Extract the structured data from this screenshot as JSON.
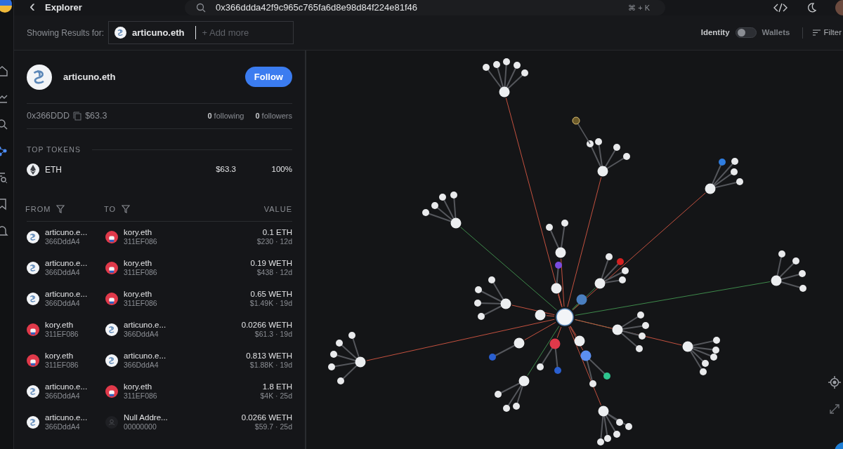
{
  "header": {
    "back": "‹",
    "title": "Explorer",
    "search": {
      "value": "0x366ddda42f9c965c765fa6d8e98d84f224e81f46",
      "shortcut": "⌘ + K"
    }
  },
  "sidebar": {
    "items": [
      {
        "kind": "home",
        "selected": false
      },
      {
        "kind": "chart",
        "selected": false
      },
      {
        "kind": "search",
        "selected": false
      },
      {
        "kind": "graph",
        "selected": true
      },
      {
        "kind": "doc-search",
        "selected": false
      },
      {
        "kind": "bookmark",
        "selected": false
      },
      {
        "kind": "bell",
        "selected": false
      }
    ]
  },
  "results_bar": {
    "label": "Showing Results for:",
    "chips": [
      {
        "name": "articuno.eth",
        "kind": "articuno"
      }
    ],
    "add_placeholder": "+ Add more"
  },
  "view_toggle": {
    "left_label": "Identity",
    "right_label": "Wallets",
    "on": false,
    "filter": "Filter"
  },
  "profile": {
    "name": "articuno.eth",
    "kind": "articuno",
    "follow": "Follow",
    "address": "0x366DDD",
    "balance": "$63.3",
    "following_count": "0",
    "following_label": "following",
    "followers_count": "0",
    "followers_label": "followers"
  },
  "top_tokens": {
    "title": "TOP TOKENS",
    "items": [
      {
        "symbol": "ETH",
        "value": "$63.3",
        "share": "100%"
      }
    ]
  },
  "transfers": {
    "columns": [
      "FROM",
      "TO",
      "VALUE"
    ],
    "rows": [
      {
        "from": {
          "name": "articuno.e...",
          "address": "366DddA4",
          "kind": "articuno"
        },
        "to": {
          "name": "kory.eth",
          "address": "311EF086",
          "kind": "kory"
        },
        "amount": "0.1 ETH",
        "detail": "$230 · 12d"
      },
      {
        "from": {
          "name": "articuno.e...",
          "address": "366DddA4",
          "kind": "articuno"
        },
        "to": {
          "name": "kory.eth",
          "address": "311EF086",
          "kind": "kory"
        },
        "amount": "0.19 WETH",
        "detail": "$438 · 12d"
      },
      {
        "from": {
          "name": "articuno.e...",
          "address": "366DddA4",
          "kind": "articuno"
        },
        "to": {
          "name": "kory.eth",
          "address": "311EF086",
          "kind": "kory"
        },
        "amount": "0.65 WETH",
        "detail": "$1.49K · 19d"
      },
      {
        "from": {
          "name": "kory.eth",
          "address": "311EF086",
          "kind": "kory"
        },
        "to": {
          "name": "articuno.e...",
          "address": "366DddA4",
          "kind": "articuno"
        },
        "amount": "0.0266 WETH",
        "detail": "$61.3 · 19d"
      },
      {
        "from": {
          "name": "kory.eth",
          "address": "311EF086",
          "kind": "kory"
        },
        "to": {
          "name": "articuno.e...",
          "address": "366DddA4",
          "kind": "articuno"
        },
        "amount": "0.813 WETH",
        "detail": "$1.88K · 19d"
      },
      {
        "from": {
          "name": "articuno.e...",
          "address": "366DddA4",
          "kind": "articuno"
        },
        "to": {
          "name": "kory.eth",
          "address": "311EF086",
          "kind": "kory"
        },
        "amount": "1.8 ETH",
        "detail": "$4K · 25d"
      },
      {
        "from": {
          "name": "articuno.e...",
          "address": "366DddA4",
          "kind": "articuno"
        },
        "to": {
          "name": "Null Addre...",
          "address": "00000000",
          "kind": "null"
        },
        "amount": "0.0266 WETH",
        "detail": "$59.7 · 25d"
      }
    ]
  }
}
